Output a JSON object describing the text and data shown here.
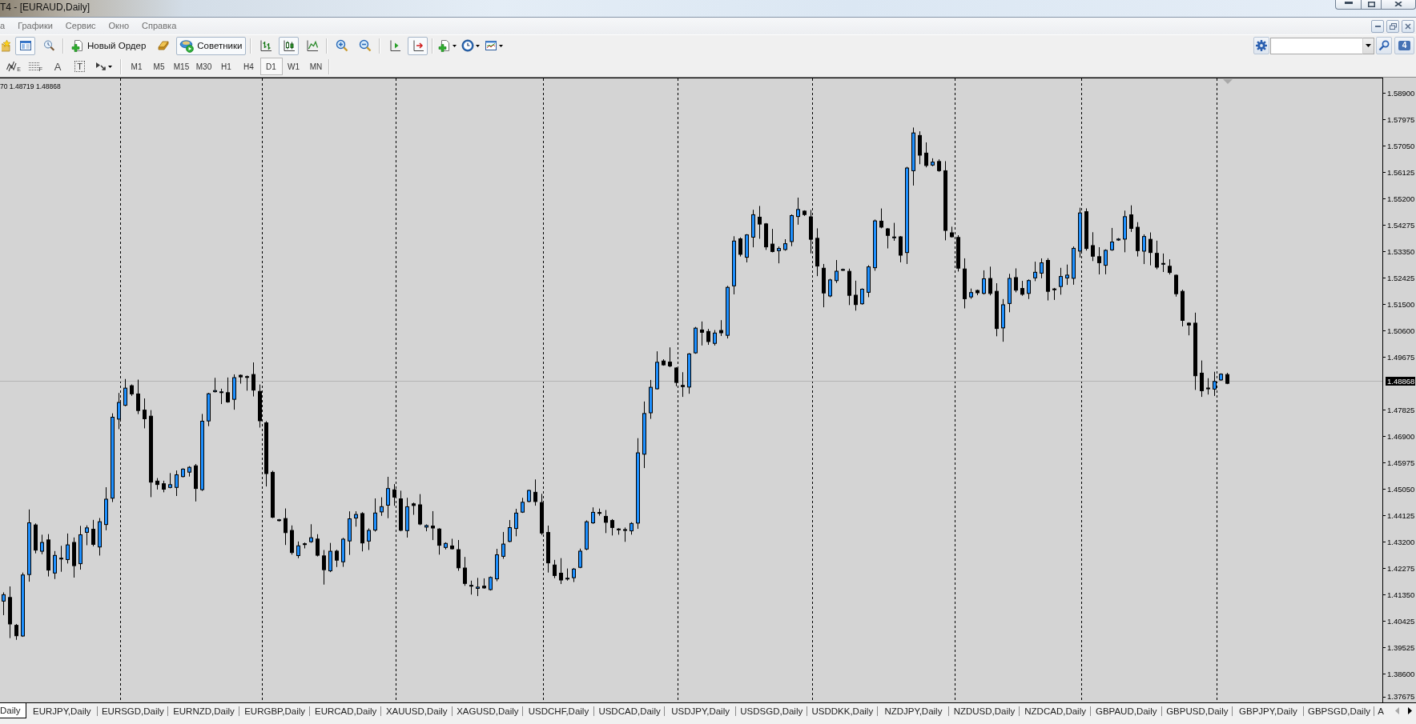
{
  "window": {
    "title": "T4 - [EURAUD,Daily]"
  },
  "menu": [
    {
      "label": "а"
    },
    {
      "label": "Графики"
    },
    {
      "label": "Сервис"
    },
    {
      "label": "Окно"
    },
    {
      "label": "Справка"
    }
  ],
  "toolbar": {
    "groups": [
      [
        {
          "kind": "favorites",
          "pressed": false
        },
        {
          "kind": "navigator",
          "pressed": true
        },
        {
          "kind": "tester",
          "pressed": false
        }
      ],
      [
        {
          "kind": "new-order",
          "label": "Новый Ордер",
          "pressed": false
        },
        {
          "kind": "editor",
          "pressed": false
        },
        {
          "kind": "experts",
          "label": "Советники",
          "pressed": true
        }
      ],
      [
        {
          "kind": "bar-chart",
          "pressed": false
        },
        {
          "kind": "candles",
          "pressed": true
        },
        {
          "kind": "line-chart",
          "pressed": false
        }
      ],
      [
        {
          "kind": "zoom-in",
          "pressed": false
        },
        {
          "kind": "zoom-out",
          "pressed": false
        }
      ],
      [
        {
          "kind": "chart-shift",
          "pressed": false
        },
        {
          "kind": "auto-scroll",
          "pressed": true
        }
      ],
      [
        {
          "kind": "new-chart",
          "pressed": false
        },
        {
          "kind": "periods",
          "pressed": false
        },
        {
          "kind": "templates",
          "pressed": false
        }
      ]
    ]
  },
  "community": {
    "unread": "4"
  },
  "tools": [
    {
      "kind": "elliott",
      "label": "E"
    },
    {
      "kind": "fibo",
      "label": "F"
    },
    {
      "kind": "text",
      "label": "A"
    },
    {
      "kind": "text-label",
      "label": "T"
    },
    {
      "kind": "arrows"
    }
  ],
  "periods": [
    {
      "label": "M1",
      "selected": false
    },
    {
      "label": "M5",
      "selected": false
    },
    {
      "label": "M15",
      "selected": false
    },
    {
      "label": "M30",
      "selected": false
    },
    {
      "label": "H1",
      "selected": false
    },
    {
      "label": "H4",
      "selected": false
    },
    {
      "label": "D1",
      "selected": true
    },
    {
      "label": "W1",
      "selected": false
    },
    {
      "label": "MN",
      "selected": false
    }
  ],
  "chart": {
    "info": "70 1.48719 1.48868",
    "price_axis": [
      {
        "kind": "tick",
        "label": "1.58900"
      },
      {
        "kind": "tick",
        "label": "1.57975"
      },
      {
        "kind": "tick",
        "label": "1.57050"
      },
      {
        "kind": "tick",
        "label": "1.56125"
      },
      {
        "kind": "tick",
        "label": "1.55200"
      },
      {
        "kind": "tick",
        "label": "1.54275"
      },
      {
        "kind": "tick",
        "label": "1.53350"
      },
      {
        "kind": "tick",
        "label": "1.52425"
      },
      {
        "kind": "tick",
        "label": "1.51500"
      },
      {
        "kind": "tick",
        "label": "1.50600"
      },
      {
        "kind": "tick",
        "label": "1.49675"
      },
      {
        "kind": "bid",
        "label": "1.48868"
      },
      {
        "kind": "tick",
        "label": "1.47825"
      },
      {
        "kind": "tick",
        "label": "1.46900"
      },
      {
        "kind": "tick",
        "label": "1.45975"
      },
      {
        "kind": "tick",
        "label": "1.45050"
      },
      {
        "kind": "tick",
        "label": "1.44125"
      },
      {
        "kind": "tick",
        "label": "1.43200"
      },
      {
        "kind": "tick",
        "label": "1.42275"
      },
      {
        "kind": "tick",
        "label": "1.41350"
      },
      {
        "kind": "tick",
        "label": "1.40425"
      },
      {
        "kind": "tick",
        "label": "1.39525"
      },
      {
        "kind": "tick",
        "label": "1.38600"
      },
      {
        "kind": "tick",
        "label": "1.37675"
      }
    ]
  },
  "tabs": [
    {
      "label": "Daily",
      "selected": true
    },
    {
      "label": "EURJPY,Daily",
      "selected": false
    },
    {
      "label": "EURSGD,Daily",
      "selected": false
    },
    {
      "label": "EURNZD,Daily",
      "selected": false
    },
    {
      "label": "EURGBP,Daily",
      "selected": false
    },
    {
      "label": "EURCAD,Daily",
      "selected": false
    },
    {
      "label": "XAUUSD,Daily",
      "selected": false
    },
    {
      "label": "XAGUSD,Daily",
      "selected": false
    },
    {
      "label": "USDCHF,Daily",
      "selected": false
    },
    {
      "label": "USDCAD,Daily",
      "selected": false
    },
    {
      "label": "USDJPY,Daily",
      "selected": false
    },
    {
      "label": "USDSGD,Daily",
      "selected": false
    },
    {
      "label": "USDDKK,Daily",
      "selected": false
    },
    {
      "label": "NZDJPY,Daily",
      "selected": false
    },
    {
      "label": "NZDUSD,Daily",
      "selected": false
    },
    {
      "label": "NZDCAD,Daily",
      "selected": false
    },
    {
      "label": "GBPAUD,Daily",
      "selected": false
    },
    {
      "label": "GBPUSD,Daily",
      "selected": false
    },
    {
      "label": "GBPJPY,Daily",
      "selected": false
    },
    {
      "label": "GBPSGD,Daily",
      "selected": false
    },
    {
      "label": "A",
      "selected": false
    }
  ],
  "tab_scroll": [
    {
      "kind": "left",
      "disabled": true
    },
    {
      "kind": "right",
      "disabled": false
    }
  ]
}
